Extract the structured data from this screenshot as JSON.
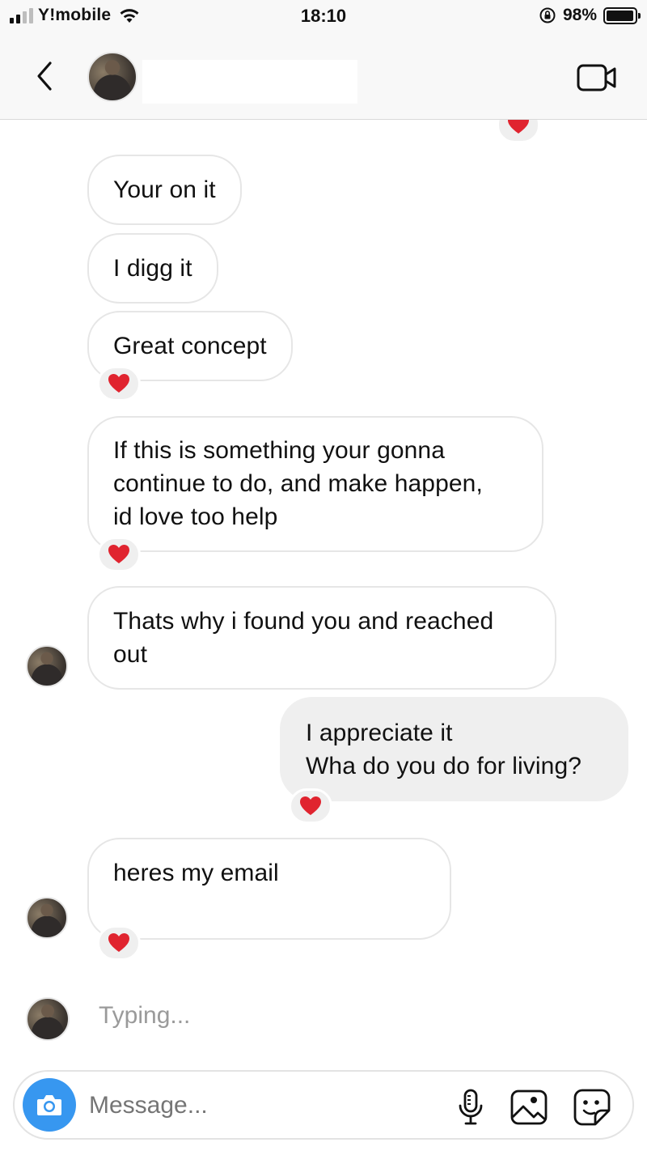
{
  "status_bar": {
    "carrier": "Y!mobile",
    "time": "18:10",
    "battery_percent": "98%",
    "battery_level": 0.98,
    "signal_bars_on": 2,
    "signal_bars_total": 4,
    "icons": [
      "signal-icon",
      "wifi-icon",
      "orientation-lock-icon",
      "battery-icon"
    ]
  },
  "header": {
    "contact_name": "",
    "icons": [
      "chevron-left-icon",
      "video-call-icon"
    ]
  },
  "messages": [
    {
      "id": "m1",
      "side": "in",
      "text": "Your on it",
      "reaction": ""
    },
    {
      "id": "m2",
      "side": "in",
      "text": "I digg it",
      "reaction": ""
    },
    {
      "id": "m3",
      "side": "in",
      "text": "Great concept",
      "reaction": "heart"
    },
    {
      "id": "m4",
      "side": "in",
      "text": "If this is something your gonna\ncontinue to do, and make happen,\nid love too help",
      "reaction": "heart"
    },
    {
      "id": "m5",
      "side": "in",
      "text": "Thats why i found you and reached\nout",
      "reaction": ""
    },
    {
      "id": "m6",
      "side": "out",
      "text": "I appreciate it\nWha do you do for living?",
      "reaction": "heart"
    },
    {
      "id": "m7",
      "side": "in",
      "text": "heres my email",
      "reaction": "heart"
    }
  ],
  "typing_indicator": "Typing...",
  "composer": {
    "placeholder": "Message...",
    "icons": [
      "camera-icon",
      "microphone-icon",
      "gallery-icon",
      "sticker-icon"
    ]
  },
  "colors": {
    "accent_blue": "#3797f0",
    "heart_red": "#e0242f",
    "incoming_border": "#e6e6e6",
    "outgoing_bg": "#efefef"
  }
}
